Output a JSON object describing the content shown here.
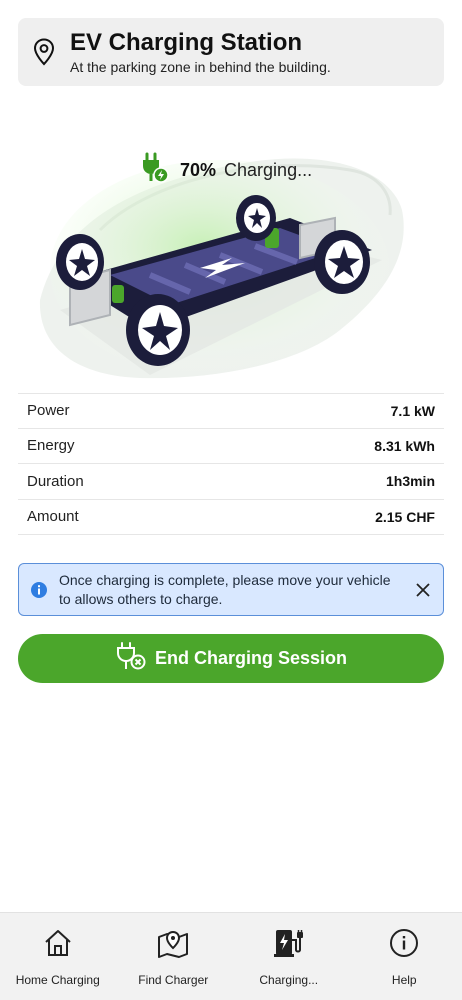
{
  "header": {
    "icon": "map-pin-icon",
    "title": "EV Charging Station",
    "subtitle": "At the parking zone in behind the building."
  },
  "charging": {
    "icon": "plug-charging-icon",
    "percent": "70%",
    "label": "Charging...",
    "progress": 0.7
  },
  "stats": [
    {
      "label": "Power",
      "value": "7.1 kW"
    },
    {
      "label": "Energy",
      "value": "8.31 kWh"
    },
    {
      "label": "Duration",
      "value": "1h3min"
    },
    {
      "label": "Amount",
      "value": "2.15 CHF"
    }
  ],
  "notice": {
    "icon": "info-icon",
    "message": "Once charging is complete, please move your vehicle to allows others to charge.",
    "close_icon": "close-icon"
  },
  "end_button": {
    "label": "End Charging Session",
    "icon": "plug-cancel-icon"
  },
  "nav": [
    {
      "label": "Home Charging",
      "icon": "home-icon"
    },
    {
      "label": "Find Charger",
      "icon": "map-icon"
    },
    {
      "label": "Charging...",
      "icon": "charging-station-icon"
    },
    {
      "label": "Help",
      "icon": "info-circle-icon"
    }
  ],
  "colors": {
    "accent_green": "#4ba62b",
    "notice_bg": "#d9e8ff",
    "notice_border": "#5b8fd9",
    "battery": "#4a4a8a"
  }
}
